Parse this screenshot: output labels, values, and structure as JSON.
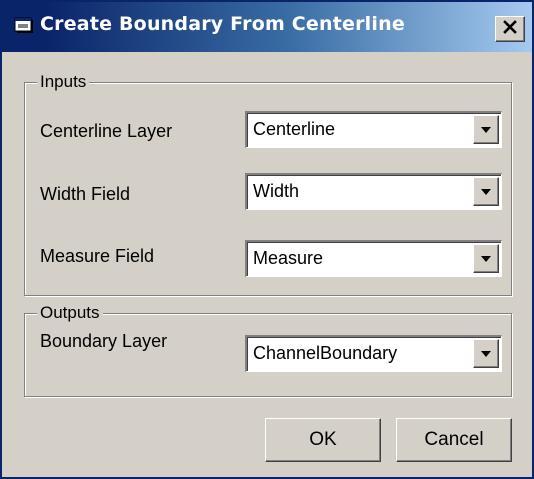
{
  "window": {
    "title": "Create Boundary From Centerline",
    "title_icon": "window-app-icon",
    "close_icon": "close-icon"
  },
  "inputs_group": {
    "legend": "Inputs",
    "fields": [
      {
        "label": "Centerline Layer",
        "value": "Centerline"
      },
      {
        "label": "Width Field",
        "value": "Width"
      },
      {
        "label": "Measure Field",
        "value": "Measure"
      }
    ]
  },
  "outputs_group": {
    "legend": "Outputs",
    "fields": [
      {
        "label": "Boundary Layer",
        "value": "ChannelBoundary"
      }
    ]
  },
  "buttons": {
    "ok": "OK",
    "cancel": "Cancel"
  },
  "colors": {
    "titlebar_start": "#0a246a",
    "titlebar_end": "#a6caf0",
    "face": "#d4d0c8"
  }
}
